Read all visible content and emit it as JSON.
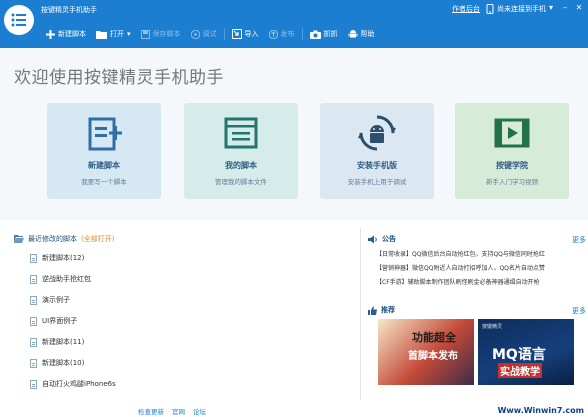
{
  "app": {
    "title": "按键精灵手机助手",
    "author_link": "作者后台",
    "phone_status": "尚未连接到手机"
  },
  "toolbar": {
    "new_script": "新建脚本",
    "open": "打开",
    "save_script": "保存脚本",
    "debug": "调试",
    "import": "导入",
    "publish": "发布",
    "capture": "抓抓",
    "help": "帮助"
  },
  "welcome": {
    "title": "欢迎使用按键精灵手机助手",
    "cards": [
      {
        "title": "新建脚本",
        "subtitle": "我要写一个脚本",
        "icon": "new-script-icon"
      },
      {
        "title": "我的脚本",
        "subtitle": "管理我的脚本文件",
        "icon": "my-scripts-icon"
      },
      {
        "title": "安装手机版",
        "subtitle": "安装手机上用于调试",
        "icon": "android-install-icon"
      },
      {
        "title": "按键学院",
        "subtitle": "新手入门学习视频",
        "icon": "video-icon"
      }
    ]
  },
  "recent": {
    "title": "最近修改的脚本",
    "open_all": "(全部打开)",
    "items": [
      "新建脚本(12)",
      "逆战助手抢红包",
      "演示例子",
      "UI界面例子",
      "新建脚本(11)",
      "新建脚本(10)",
      "自动打火鸡腿iPhone6s"
    ]
  },
  "notice": {
    "title": "公告",
    "more": "更多",
    "items": [
      "【日常收录】QQ微信后台自动抢红包，支持QQ与微信同时抢红",
      "【营销神器】微信QQ附近人自动打招呼加人，QQ名片自动点赞",
      "【CF手游】辅助脚本制作团队刷怪刷金必备神器通缉自动开枪"
    ]
  },
  "recommend": {
    "title": "推荐",
    "more": "更多",
    "banner1_line1": "功能超全",
    "banner1_line2": "首脚本发布",
    "banner2_tag": "按键精灵",
    "banner2_line1": "MQ语言",
    "banner2_line2": "实战教学"
  },
  "footer": {
    "check_update": "检查更新",
    "website": "官网",
    "forum": "论坛"
  },
  "watermark": {
    "text": "Www.Winwin7.com"
  },
  "colors": {
    "brand_blue": "#1b7ed0",
    "orange_accent": "#e08a2a"
  }
}
